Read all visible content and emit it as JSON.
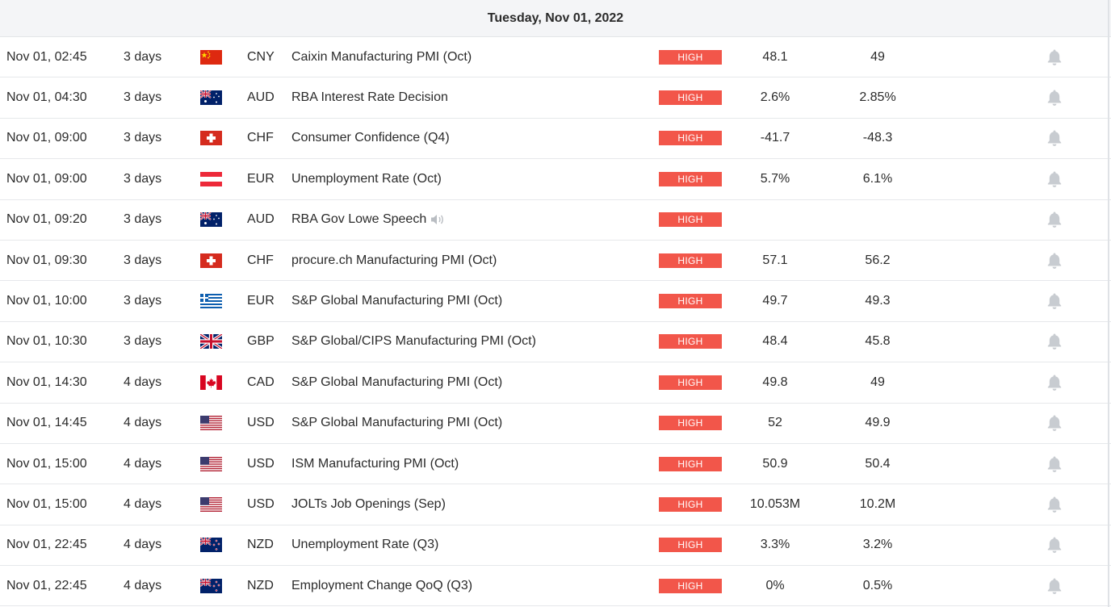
{
  "header": {
    "date": "Tuesday, Nov 01, 2022"
  },
  "colors": {
    "importance_high": "#f2564a",
    "bell": "#c8ccd1"
  },
  "events": [
    {
      "time": "Nov 01, 02:45",
      "eta": "3 days",
      "flag": "cn",
      "currency": "CNY",
      "name": "Caixin Manufacturing PMI (Oct)",
      "importance": "HIGH",
      "actual": "48.1",
      "forecast": "49",
      "speaker": false
    },
    {
      "time": "Nov 01, 04:30",
      "eta": "3 days",
      "flag": "au",
      "currency": "AUD",
      "name": "RBA Interest Rate Decision",
      "importance": "HIGH",
      "actual": "2.6%",
      "forecast": "2.85%",
      "speaker": false
    },
    {
      "time": "Nov 01, 09:00",
      "eta": "3 days",
      "flag": "ch",
      "currency": "CHF",
      "name": "Consumer Confidence (Q4)",
      "importance": "HIGH",
      "actual": "-41.7",
      "forecast": "-48.3",
      "speaker": false
    },
    {
      "time": "Nov 01, 09:00",
      "eta": "3 days",
      "flag": "at",
      "currency": "EUR",
      "name": "Unemployment Rate (Oct)",
      "importance": "HIGH",
      "actual": "5.7%",
      "forecast": "6.1%",
      "speaker": false
    },
    {
      "time": "Nov 01, 09:20",
      "eta": "3 days",
      "flag": "au",
      "currency": "AUD",
      "name": "RBA Gov Lowe Speech",
      "importance": "HIGH",
      "actual": "",
      "forecast": "",
      "speaker": true
    },
    {
      "time": "Nov 01, 09:30",
      "eta": "3 days",
      "flag": "ch",
      "currency": "CHF",
      "name": "procure.ch Manufacturing PMI (Oct)",
      "importance": "HIGH",
      "actual": "57.1",
      "forecast": "56.2",
      "speaker": false
    },
    {
      "time": "Nov 01, 10:00",
      "eta": "3 days",
      "flag": "gr",
      "currency": "EUR",
      "name": "S&P Global Manufacturing PMI (Oct)",
      "importance": "HIGH",
      "actual": "49.7",
      "forecast": "49.3",
      "speaker": false
    },
    {
      "time": "Nov 01, 10:30",
      "eta": "3 days",
      "flag": "gb",
      "currency": "GBP",
      "name": "S&P Global/CIPS Manufacturing PMI (Oct)",
      "importance": "HIGH",
      "actual": "48.4",
      "forecast": "45.8",
      "speaker": false
    },
    {
      "time": "Nov 01, 14:30",
      "eta": "4 days",
      "flag": "ca",
      "currency": "CAD",
      "name": "S&P Global Manufacturing PMI (Oct)",
      "importance": "HIGH",
      "actual": "49.8",
      "forecast": "49",
      "speaker": false
    },
    {
      "time": "Nov 01, 14:45",
      "eta": "4 days",
      "flag": "us",
      "currency": "USD",
      "name": "S&P Global Manufacturing PMI (Oct)",
      "importance": "HIGH",
      "actual": "52",
      "forecast": "49.9",
      "speaker": false
    },
    {
      "time": "Nov 01, 15:00",
      "eta": "4 days",
      "flag": "us",
      "currency": "USD",
      "name": "ISM Manufacturing PMI (Oct)",
      "importance": "HIGH",
      "actual": "50.9",
      "forecast": "50.4",
      "speaker": false
    },
    {
      "time": "Nov 01, 15:00",
      "eta": "4 days",
      "flag": "us",
      "currency": "USD",
      "name": "JOLTs Job Openings (Sep)",
      "importance": "HIGH",
      "actual": "10.053M",
      "forecast": "10.2M",
      "speaker": false
    },
    {
      "time": "Nov 01, 22:45",
      "eta": "4 days",
      "flag": "nz",
      "currency": "NZD",
      "name": "Unemployment Rate (Q3)",
      "importance": "HIGH",
      "actual": "3.3%",
      "forecast": "3.2%",
      "speaker": false
    },
    {
      "time": "Nov 01, 22:45",
      "eta": "4 days",
      "flag": "nz",
      "currency": "NZD",
      "name": "Employment Change QoQ (Q3)",
      "importance": "HIGH",
      "actual": "0%",
      "forecast": "0.5%",
      "speaker": false
    }
  ]
}
